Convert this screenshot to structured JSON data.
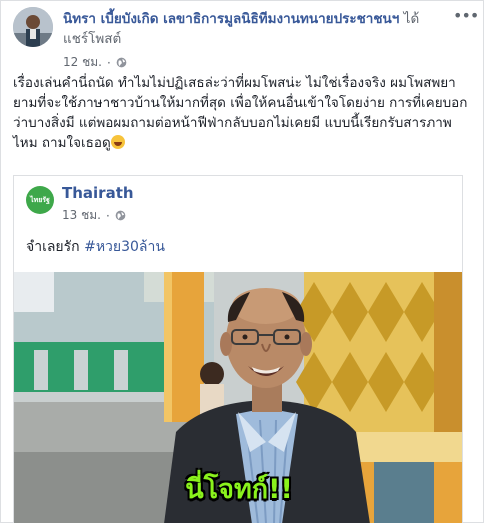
{
  "post": {
    "author": "นิทรา เบี้ยบังเกิด เลขาธิการมูลนิธิทีมงานทนายประชาชนฯ",
    "action": "ได้แชร์โพสต์",
    "time": "12 ชม.",
    "privacy_icon": "globe-icon",
    "more_icon": "more-icon",
    "text": "เรื่องเล่นคำนี่ถนัด ทำไมไม่ปฏิเสธล่ะว่าที่ผมโพสน่ะ ไม่ใช่เรื่องจริง ผมโพสพยายามที่จะใช้ภาษาชาวบ้านให้มากที่สุด เพื่อให้คนอื่นเข้าใจโดยง่าย การที่เคยบอกว่าบางสิ่งมี แต่พอผมถามต่อหน้าฟีฟ่ากลับบอกไม่เคยมี แบบนี้เรียกรับสารภาพไหม ถามใจเธอดู",
    "emoji": "rolling-on-floor-laughing-emoji"
  },
  "shared": {
    "page_name": "Thairath",
    "avatar_text": "ไทยรัฐ",
    "time": "13 ชม.",
    "privacy_icon": "globe-icon",
    "text_prefix": "จำเลยรัก",
    "hashtag": "#หวย30ล้าน",
    "image_caption": "นี่โจทก์!!"
  },
  "colors": {
    "link": "#385898",
    "text": "#1d2129",
    "meta": "#616770",
    "caption": "#8af21c",
    "page_avatar": "#3ea84a"
  }
}
